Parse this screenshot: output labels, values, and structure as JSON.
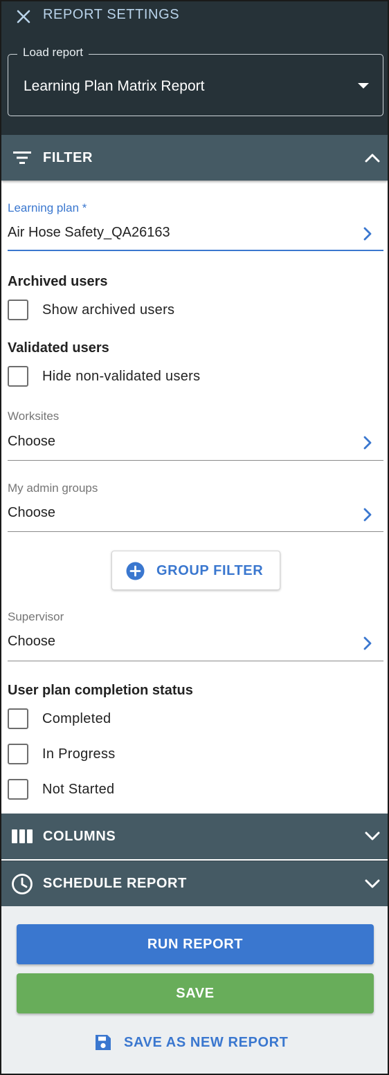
{
  "header": {
    "title": "REPORT SETTINGS",
    "close_icon": "close-icon"
  },
  "load_report": {
    "label": "Load report",
    "value": "Learning Plan Matrix Report"
  },
  "filter_section": {
    "label": "FILTER",
    "expanded": true,
    "learning_plan": {
      "label": "Learning plan *",
      "value": "Air Hose Safety_QA26163"
    },
    "archived_users": {
      "title": "Archived users",
      "checkbox_label": "Show archived users",
      "checked": false
    },
    "validated_users": {
      "title": "Validated users",
      "checkbox_label": "Hide non-validated users",
      "checked": false
    },
    "worksites": {
      "label": "Worksites",
      "value": "Choose"
    },
    "admin_groups": {
      "label": "My admin groups",
      "value": "Choose"
    },
    "group_filter_button": "GROUP FILTER",
    "supervisor": {
      "label": "Supervisor",
      "value": "Choose"
    },
    "completion_status": {
      "title": "User plan completion status",
      "options": [
        {
          "label": "Completed",
          "checked": false
        },
        {
          "label": "In Progress",
          "checked": false
        },
        {
          "label": "Not Started",
          "checked": false
        }
      ]
    }
  },
  "columns_section": {
    "label": "COLUMNS",
    "expanded": false
  },
  "schedule_section": {
    "label": "SCHEDULE REPORT",
    "expanded": false
  },
  "footer": {
    "run_label": "RUN REPORT",
    "save_label": "SAVE",
    "save_new_label": "SAVE AS NEW REPORT"
  },
  "colors": {
    "header_bg": "#263238",
    "section_bg": "#455a64",
    "accent_blue": "#3a77cf",
    "save_green": "#68ad5a",
    "footer_bg": "#eceff1"
  }
}
